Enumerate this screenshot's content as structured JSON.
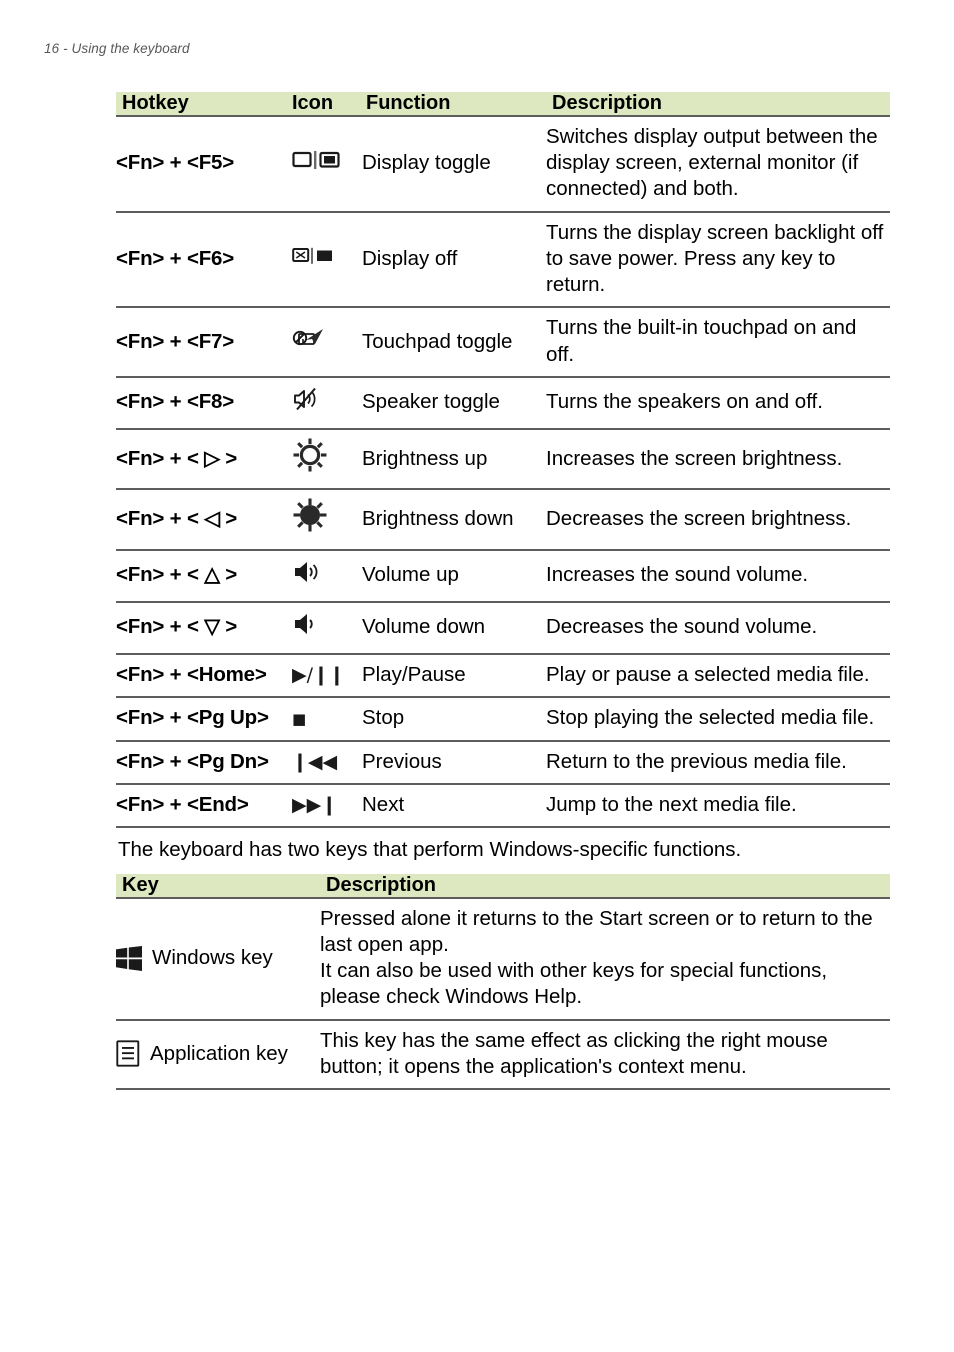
{
  "running_head": "16 - Using the keyboard",
  "hotkey_table": {
    "headers": {
      "hotkey": "Hotkey",
      "icon": "Icon",
      "function": "Function",
      "description": "Description"
    },
    "rows": [
      {
        "hotkey": "<Fn> + <F5>",
        "icon_name": "display-toggle-icon",
        "function": "Display toggle",
        "description": "Switches display output between the display screen, external monitor (if connected) and both."
      },
      {
        "hotkey": "<Fn> + <F6>",
        "icon_name": "display-off-icon",
        "function": "Display off",
        "description": "Turns the display screen backlight off to save power. Press any key to return."
      },
      {
        "hotkey": "<Fn> + <F7>",
        "icon_name": "touchpad-toggle-icon",
        "function": "Touchpad toggle",
        "description": "Turns the built-in touchpad on and off."
      },
      {
        "hotkey": "<Fn> + <F8>",
        "icon_name": "speaker-mute-icon",
        "function": "Speaker toggle",
        "description": "Turns the speakers on and off."
      },
      {
        "hotkey": "<Fn> + < ▷ >",
        "icon_name": "sun-outline-icon",
        "function": "Brightness up",
        "description": "Increases the screen brightness."
      },
      {
        "hotkey": "<Fn> + < ◁ >",
        "icon_name": "sun-filled-icon",
        "function": "Brightness down",
        "description": "Decreases the screen brightness."
      },
      {
        "hotkey": "<Fn> + < △ >",
        "icon_name": "volume-up-icon",
        "function": "Volume up",
        "description": "Increases the sound volume."
      },
      {
        "hotkey": "<Fn> + < ▽ >",
        "icon_name": "volume-down-icon",
        "function": "Volume down",
        "description": "Decreases the sound volume."
      },
      {
        "hotkey": "<Fn> + <Home>",
        "icon_name": "play-pause-icon",
        "icon_glyph": "▶/❙❙",
        "function": "Play/Pause",
        "description": "Play or pause a selected media file."
      },
      {
        "hotkey": "<Fn> + <Pg Up>",
        "icon_name": "stop-icon",
        "icon_glyph": "■",
        "function": "Stop",
        "description": "Stop playing the selected media file."
      },
      {
        "hotkey": "<Fn> + <Pg Dn>",
        "icon_name": "previous-track-icon",
        "icon_glyph": "❙◀◀",
        "function": "Previous",
        "description": "Return to the previous media file."
      },
      {
        "hotkey": "<Fn> + <End>",
        "icon_name": "next-track-icon",
        "icon_glyph": "▶▶❙",
        "function": "Next",
        "description": "Jump to the next media file."
      }
    ]
  },
  "middle_paragraph": "The keyboard has two keys that perform Windows-specific functions.",
  "key_table": {
    "headers": {
      "key": "Key",
      "description": "Description"
    },
    "rows": [
      {
        "icon_name": "windows-key-icon",
        "key": "Windows key",
        "description_lines": [
          "Pressed alone it returns to the Start screen or to return to the last open app.",
          "It can also be used with other keys for special functions, please check Windows Help."
        ]
      },
      {
        "icon_name": "application-key-icon",
        "key": "Application key",
        "description_lines": [
          "This key has the same effect as clicking the right mouse button; it opens the application's context menu."
        ]
      }
    ]
  },
  "colors": {
    "header_green": "#dde8c0",
    "rule_gray": "#5d5d5d",
    "running_head_gray": "#58585a",
    "text_black": "#000000"
  }
}
